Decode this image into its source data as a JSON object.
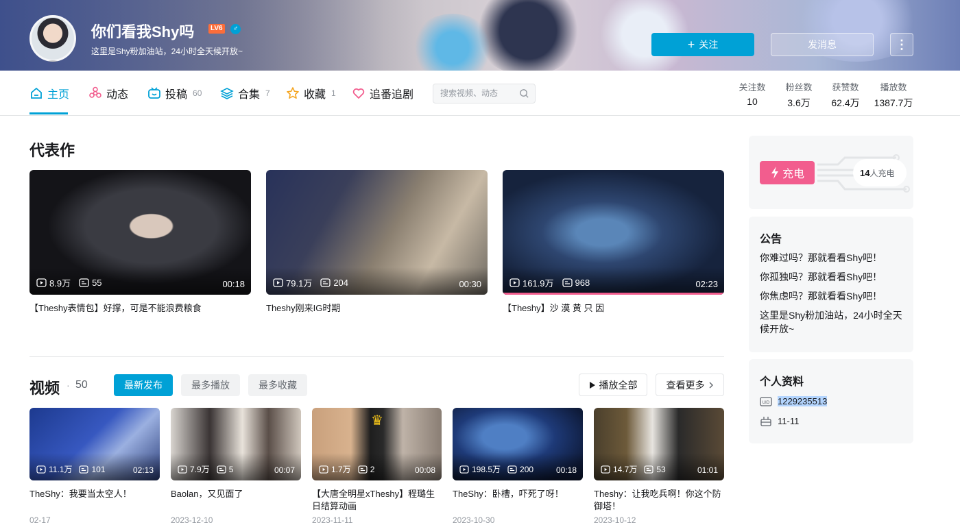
{
  "profile": {
    "name": "你们看我Shy吗",
    "level": "LV6",
    "gender_icon": "male-icon",
    "sign": "这里是Shy粉加油站，24小时全天候开放~"
  },
  "actions": {
    "follow": "关注",
    "message": "发消息",
    "more": "⋮"
  },
  "nav": {
    "items": [
      {
        "label": "主页",
        "count": "",
        "icon": "home-icon"
      },
      {
        "label": "动态",
        "count": "",
        "icon": "dynamic-icon"
      },
      {
        "label": "投稿",
        "count": "60",
        "icon": "tv-icon"
      },
      {
        "label": "合集",
        "count": "7",
        "icon": "layers-icon"
      },
      {
        "label": "收藏",
        "count": "1",
        "icon": "star-icon"
      },
      {
        "label": "追番追剧",
        "count": "",
        "icon": "heart-icon"
      }
    ],
    "search_placeholder": "搜索视频、动态"
  },
  "stats": [
    {
      "label": "关注数",
      "value": "10"
    },
    {
      "label": "粉丝数",
      "value": "3.6万"
    },
    {
      "label": "获赞数",
      "value": "62.4万"
    },
    {
      "label": "播放数",
      "value": "1387.7万"
    }
  ],
  "masterpiece": {
    "title": "代表作",
    "videos": [
      {
        "views": "8.9万",
        "danmaku": "55",
        "duration": "00:18",
        "title": "【Theshy表情包】好撑，可是不能浪费粮食"
      },
      {
        "views": "79.1万",
        "danmaku": "204",
        "duration": "00:30",
        "title": "Theshy刚来IG时期"
      },
      {
        "views": "161.9万",
        "danmaku": "968",
        "duration": "02:23",
        "title": "【Theshy】沙 漠 黄 只 因"
      }
    ]
  },
  "videos": {
    "title": "视频",
    "dot": "·",
    "count": "50",
    "tabs": [
      "最新发布",
      "最多播放",
      "最多收藏"
    ],
    "play_all": "播放全部",
    "see_more": "查看更多",
    "list": [
      {
        "views": "11.1万",
        "danmaku": "101",
        "duration": "02:13",
        "title": "TheShy：我要当太空人！",
        "date": "02-17"
      },
      {
        "views": "7.9万",
        "danmaku": "5",
        "duration": "00:07",
        "title": "Baolan，又见面了",
        "date": "2023-12-10"
      },
      {
        "views": "1.7万",
        "danmaku": "2",
        "duration": "00:08",
        "title": "【大唐全明星xTheshy】程璐生日结算动画",
        "date": "2023-11-11"
      },
      {
        "views": "198.5万",
        "danmaku": "200",
        "duration": "00:18",
        "title": "TheShy：卧槽，吓死了呀！",
        "date": "2023-10-30"
      },
      {
        "views": "14.7万",
        "danmaku": "53",
        "duration": "01:01",
        "title": "Theshy：让我吃兵啊！你这个防御塔！",
        "date": "2023-10-12"
      }
    ]
  },
  "charge": {
    "button": "充电",
    "count": "14",
    "suffix": "人充电"
  },
  "notice": {
    "title": "公告",
    "lines": [
      "你难过吗？那就看看Shy吧！",
      "你孤独吗？那就看看Shy吧！",
      "你焦虑吗？那就看看Shy吧！",
      "这里是Shy粉加油站，24小时全天候开放~"
    ]
  },
  "personal": {
    "title": "个人资料",
    "uid": "1229235513",
    "birthday": "11-11"
  },
  "colors": {
    "accent": "#00a1d6",
    "charge": "#f25d8e",
    "level": "#fb6d3a"
  }
}
